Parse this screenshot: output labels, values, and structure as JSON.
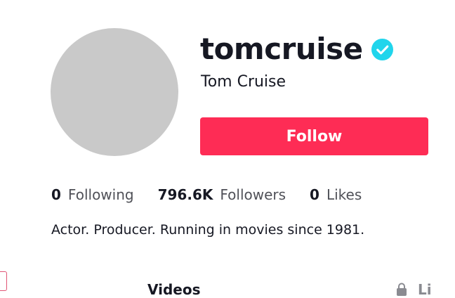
{
  "profile": {
    "username": "tomcruise",
    "display_name": "Tom Cruise",
    "verified": true,
    "follow_label": "Follow",
    "bio": "Actor. Producer. Running in movies since 1981."
  },
  "stats": [
    {
      "value": "0",
      "label": "Following"
    },
    {
      "value": "796.6K",
      "label": "Followers"
    },
    {
      "value": "0",
      "label": "Likes"
    }
  ],
  "tabs": {
    "videos": "Videos",
    "liked": "Li"
  },
  "colors": {
    "accent": "#fe2c55",
    "verified": "#20d5ec",
    "text": "#161823",
    "muted": "#505158"
  }
}
